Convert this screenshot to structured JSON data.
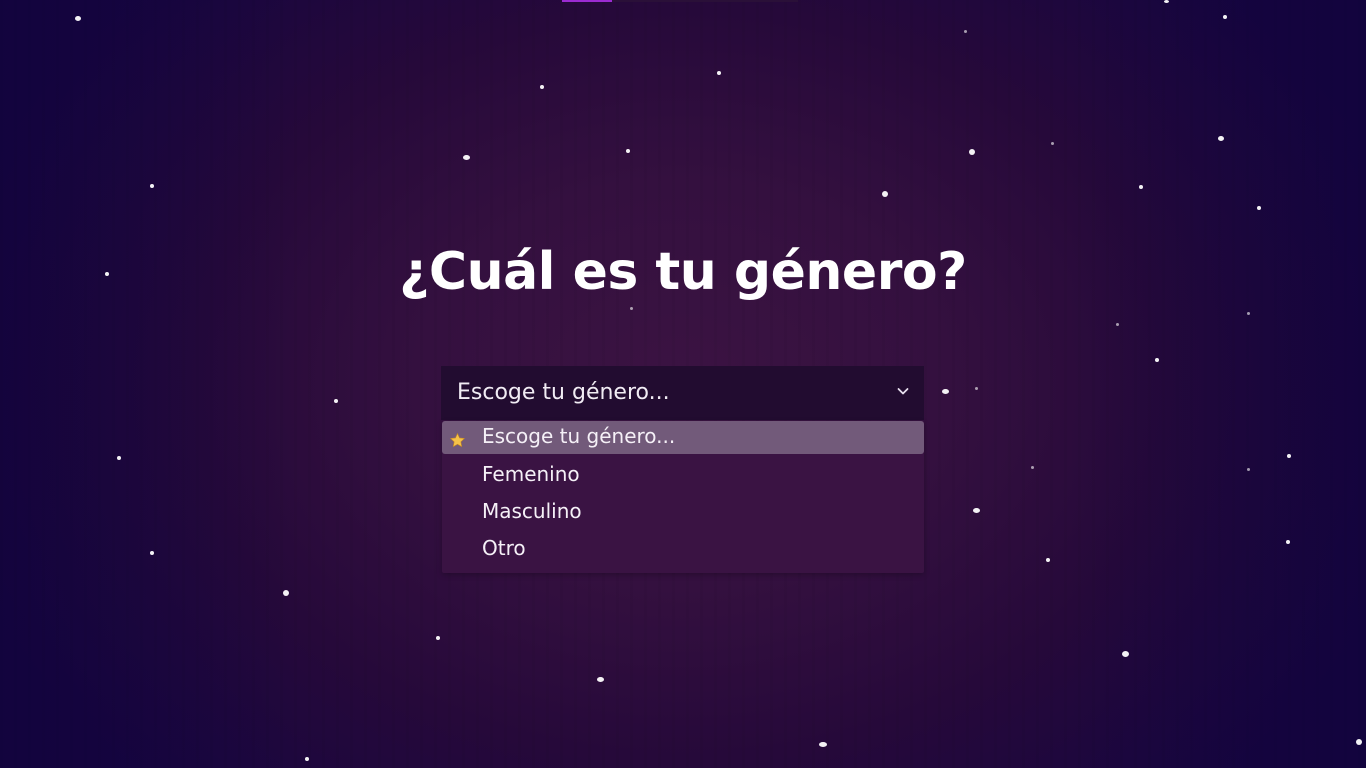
{
  "page": {
    "question": "¿Cuál es tu género?"
  },
  "select": {
    "value": "Escoge tu género...",
    "options": [
      {
        "label": "Escoge tu género...",
        "selected": true
      },
      {
        "label": "Femenino",
        "selected": false
      },
      {
        "label": "Masculino",
        "selected": false
      },
      {
        "label": "Otro",
        "selected": false
      }
    ]
  },
  "icons": {
    "selected_marker": "star-icon",
    "dropdown_toggle": "chevron-down-icon"
  },
  "colors": {
    "background": "#34103f",
    "select_bg": "#220c30",
    "dropdown_bg": "#3a1343",
    "highlight_bg": "#725a7a",
    "star": "#f4c24a"
  }
}
